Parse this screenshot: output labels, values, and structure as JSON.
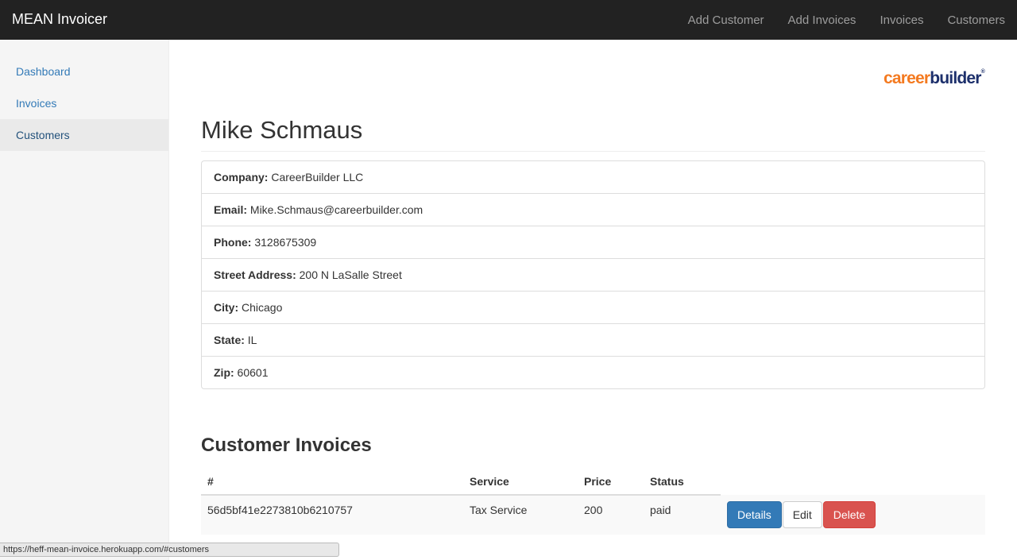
{
  "navbar": {
    "brand": "MEAN Invoicer",
    "links": [
      "Add Customer",
      "Add Invoices",
      "Invoices",
      "Customers"
    ]
  },
  "sidebar": {
    "items": [
      {
        "label": "Dashboard",
        "active": false
      },
      {
        "label": "Invoices",
        "active": false
      },
      {
        "label": "Customers",
        "active": true
      }
    ]
  },
  "logo": {
    "part1": "career",
    "part2": "builder",
    "mark": "®"
  },
  "customer": {
    "name": "Mike Schmaus",
    "fields": [
      {
        "label": "Company:",
        "value": "CareerBuilder LLC"
      },
      {
        "label": "Email:",
        "value": "Mike.Schmaus@careerbuilder.com"
      },
      {
        "label": "Phone:",
        "value": "3128675309"
      },
      {
        "label": "Street Address:",
        "value": "200 N LaSalle Street"
      },
      {
        "label": "City:",
        "value": "Chicago"
      },
      {
        "label": "State:",
        "value": "IL"
      },
      {
        "label": "Zip:",
        "value": "60601"
      }
    ]
  },
  "invoices": {
    "title": "Customer Invoices",
    "columns": [
      "#",
      "Service",
      "Price",
      "Status"
    ],
    "rows": [
      {
        "id": "56d5bf41e2273810b6210757",
        "service": "Tax Service",
        "price": "200",
        "status": "paid"
      }
    ],
    "buttons": {
      "details": "Details",
      "edit": "Edit",
      "delete": "Delete"
    }
  },
  "statusbar": {
    "url": "https://heff-mean-invoice.herokuapp.com/#customers"
  },
  "colors": {
    "navbar": "#222222",
    "link": "#337ab7",
    "primary": "#337ab7",
    "danger": "#d9534f",
    "logo_orange": "#f47a20",
    "logo_navy": "#1c2f6b"
  }
}
